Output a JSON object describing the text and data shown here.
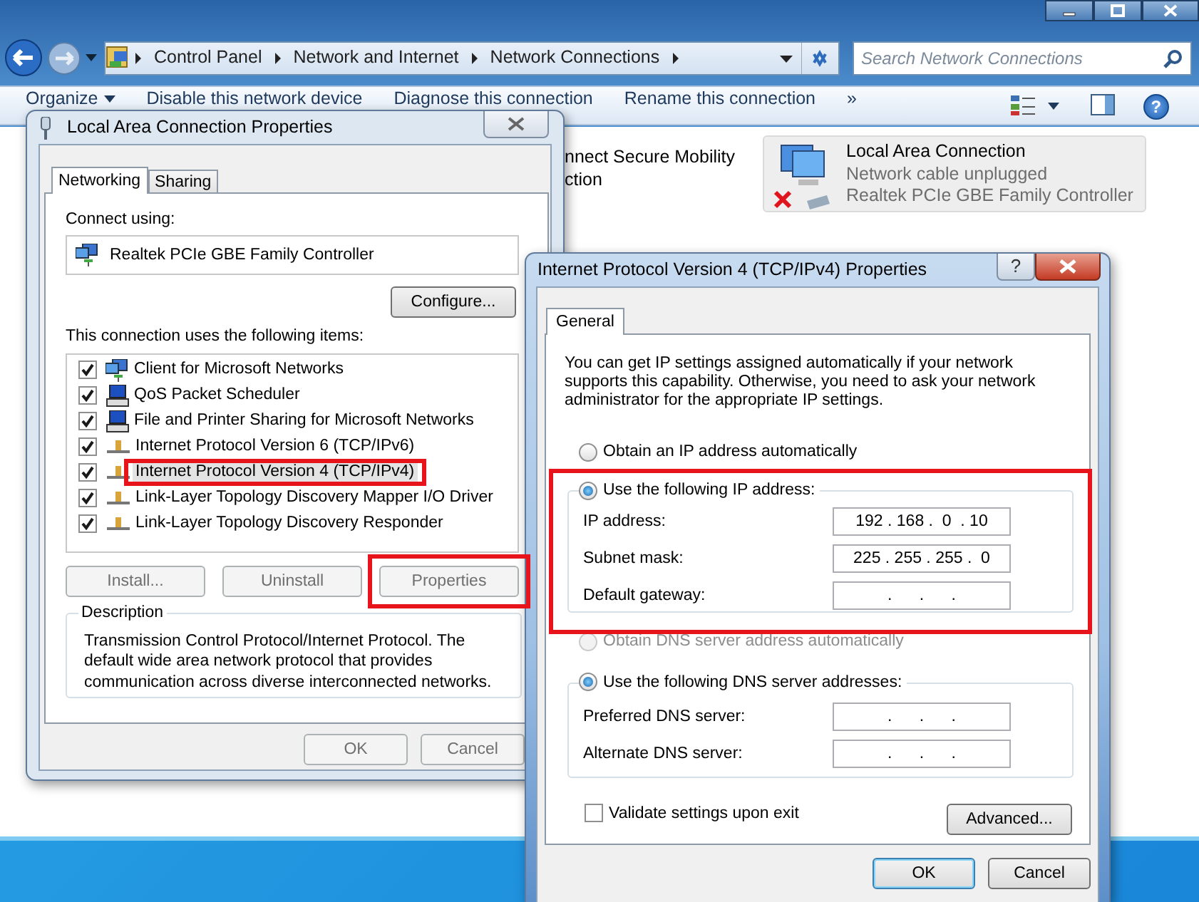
{
  "explorer": {
    "breadcrumb": [
      "Control Panel",
      "Network and Internet",
      "Network Connections"
    ],
    "search": {
      "placeholder": "Search Network Connections"
    },
    "toolbar": [
      {
        "label": "Organize",
        "kind": "menu"
      },
      {
        "label": "Disable this network device",
        "kind": "command"
      },
      {
        "label": "Diagnose this connection",
        "kind": "command"
      },
      {
        "label": "Rename this connection",
        "kind": "command"
      },
      {
        "label": "»",
        "kind": "more"
      }
    ],
    "help_button": "?",
    "connections": [
      {
        "kind": "partial",
        "selected": false,
        "lines": [
          "nnect Secure Mobility",
          "ction"
        ]
      },
      {
        "kind": "lan",
        "selected": true,
        "lines": [
          "Local Area Connection",
          "Network cable unplugged",
          "Realtek PCIe GBE Family Controller"
        ]
      }
    ]
  },
  "lan_properties": {
    "title": "Local Area Connection Properties",
    "tabs": [
      {
        "label": "Networking",
        "selected": true
      },
      {
        "label": "Sharing",
        "selected": false
      }
    ],
    "connect_using_label": "Connect using:",
    "adapter": "Realtek PCIe GBE Family Controller",
    "configure_button": "Configure...",
    "items_label": "This connection uses the following items:",
    "items": [
      {
        "label": "Client for Microsoft Networks",
        "kind": "client",
        "checked": true,
        "selected": false
      },
      {
        "label": "QoS Packet Scheduler",
        "kind": "service",
        "checked": true,
        "selected": false
      },
      {
        "label": "File and Printer Sharing for Microsoft Networks",
        "kind": "service",
        "checked": true,
        "selected": false
      },
      {
        "label": "Internet Protocol Version 6 (TCP/IPv6)",
        "kind": "protocol",
        "checked": true,
        "selected": false
      },
      {
        "label": "Internet Protocol Version 4 (TCP/IPv4)",
        "kind": "protocol",
        "checked": true,
        "selected": true
      },
      {
        "label": "Link-Layer Topology Discovery Mapper I/O Driver",
        "kind": "protocol",
        "checked": true,
        "selected": false
      },
      {
        "label": "Link-Layer Topology Discovery Responder",
        "kind": "protocol",
        "checked": true,
        "selected": false
      }
    ],
    "buttons": [
      {
        "label": "Install...",
        "disabled": true
      },
      {
        "label": "Uninstall",
        "disabled": true
      },
      {
        "label": "Properties",
        "disabled": true
      }
    ],
    "description_title": "Description",
    "description": "Transmission Control Protocol/Internet Protocol. The default wide area network protocol that provides communication across diverse interconnected networks.",
    "footer_buttons": [
      {
        "label": "OK",
        "disabled": true
      },
      {
        "label": "Cancel",
        "disabled": true
      }
    ]
  },
  "ipv4_properties": {
    "title": "Internet Protocol Version 4 (TCP/IPv4) Properties",
    "help_button": "?",
    "tabs": [
      {
        "label": "General",
        "selected": true
      }
    ],
    "intro": "You can get IP settings assigned automatically if your network supports this capability. Otherwise, you need to ask your network administrator for the appropriate IP settings.",
    "ip_options": [
      {
        "label": "Obtain an IP address automatically",
        "selected": false,
        "disabled": false
      },
      {
        "label": "Use the following IP address:",
        "selected": true,
        "disabled": false
      }
    ],
    "ip_fields": [
      {
        "label": "IP address:",
        "value": "192 . 168 .  0  . 10"
      },
      {
        "label": "Subnet mask:",
        "value": "225 . 255 . 255 .  0"
      },
      {
        "label": "Default gateway:",
        "value": ".      .      ."
      }
    ],
    "dns_options": [
      {
        "label": "Obtain DNS server address automatically",
        "selected": false,
        "disabled": true
      },
      {
        "label": "Use the following DNS server addresses:",
        "selected": true,
        "disabled": false
      }
    ],
    "dns_fields": [
      {
        "label": "Preferred DNS server:",
        "value": ".      .      ."
      },
      {
        "label": "Alternate DNS server:",
        "value": ".      .      ."
      }
    ],
    "validate": {
      "label": "Validate settings upon exit",
      "checked": false
    },
    "advanced_button": "Advanced...",
    "buttons": [
      {
        "label": "OK",
        "default": true
      },
      {
        "label": "Cancel",
        "default": false
      }
    ]
  }
}
